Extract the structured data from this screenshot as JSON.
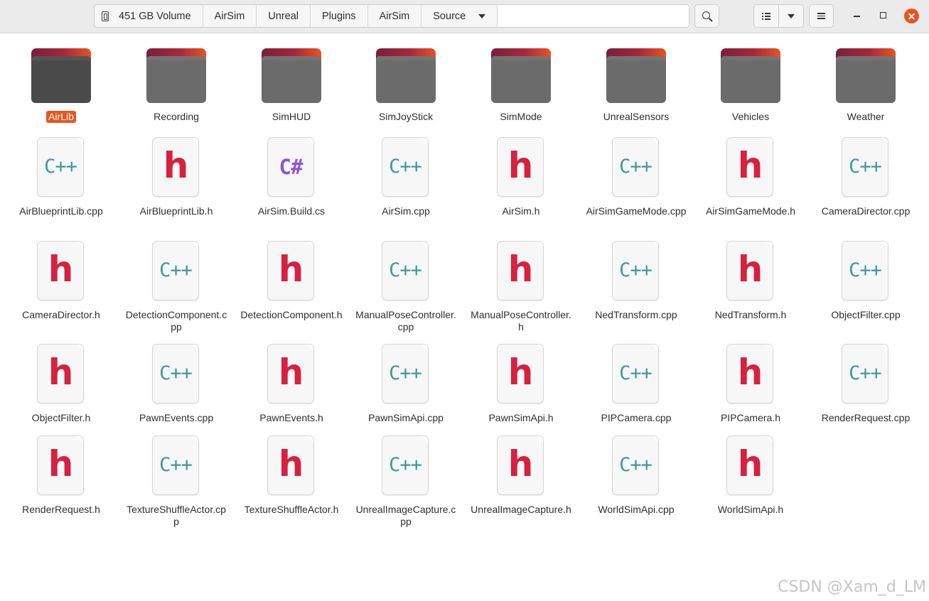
{
  "breadcrumbs": [
    {
      "label": "451 GB Volume",
      "icon": "drive-icon"
    },
    {
      "label": "AirSim"
    },
    {
      "label": "Unreal"
    },
    {
      "label": "Plugins"
    },
    {
      "label": "AirSim"
    },
    {
      "label": "Source",
      "has_dropdown": true
    }
  ],
  "colors": {
    "accent": "#e95420",
    "cpp_glyph": "#3d9a9e",
    "h_glyph": "#d6213f",
    "cs_glyph": "#8f56c9"
  },
  "files": [
    {
      "name": "AirLib",
      "type": "folder",
      "selected": true
    },
    {
      "name": "Recording",
      "type": "folder"
    },
    {
      "name": "SimHUD",
      "type": "folder"
    },
    {
      "name": "SimJoyStick",
      "type": "folder"
    },
    {
      "name": "SimMode",
      "type": "folder"
    },
    {
      "name": "UnrealSensors",
      "type": "folder"
    },
    {
      "name": "Vehicles",
      "type": "folder"
    },
    {
      "name": "Weather",
      "type": "folder"
    },
    {
      "name": "AirBlueprintLib.cpp",
      "type": "cpp",
      "glyph": "C++"
    },
    {
      "name": "AirBlueprintLib.h",
      "type": "h",
      "glyph": "h"
    },
    {
      "name": "AirSim.Build.cs",
      "type": "cs",
      "glyph": "C#"
    },
    {
      "name": "AirSim.cpp",
      "type": "cpp",
      "glyph": "C++"
    },
    {
      "name": "AirSim.h",
      "type": "h",
      "glyph": "h"
    },
    {
      "name": "AirSimGameMode.cpp",
      "type": "cpp",
      "glyph": "C++"
    },
    {
      "name": "AirSimGameMode.h",
      "type": "h",
      "glyph": "h"
    },
    {
      "name": "CameraDirector.cpp",
      "type": "cpp",
      "glyph": "C++"
    },
    {
      "name": "CameraDirector.h",
      "type": "h",
      "glyph": "h"
    },
    {
      "name": "DetectionComponent.cpp",
      "type": "cpp",
      "glyph": "C++"
    },
    {
      "name": "DetectionComponent.h",
      "type": "h",
      "glyph": "h"
    },
    {
      "name": "ManualPoseController.cpp",
      "type": "cpp",
      "glyph": "C++"
    },
    {
      "name": "ManualPoseController.h",
      "type": "h",
      "glyph": "h"
    },
    {
      "name": "NedTransform.cpp",
      "type": "cpp",
      "glyph": "C++"
    },
    {
      "name": "NedTransform.h",
      "type": "h",
      "glyph": "h"
    },
    {
      "name": "ObjectFilter.cpp",
      "type": "cpp",
      "glyph": "C++"
    },
    {
      "name": "ObjectFilter.h",
      "type": "h",
      "glyph": "h"
    },
    {
      "name": "PawnEvents.cpp",
      "type": "cpp",
      "glyph": "C++"
    },
    {
      "name": "PawnEvents.h",
      "type": "h",
      "glyph": "h"
    },
    {
      "name": "PawnSimApi.cpp",
      "type": "cpp",
      "glyph": "C++"
    },
    {
      "name": "PawnSimApi.h",
      "type": "h",
      "glyph": "h"
    },
    {
      "name": "PIPCamera.cpp",
      "type": "cpp",
      "glyph": "C++"
    },
    {
      "name": "PIPCamera.h",
      "type": "h",
      "glyph": "h"
    },
    {
      "name": "RenderRequest.cpp",
      "type": "cpp",
      "glyph": "C++"
    },
    {
      "name": "RenderRequest.h",
      "type": "h",
      "glyph": "h"
    },
    {
      "name": "TextureShuffleActor.cpp",
      "type": "cpp",
      "glyph": "C++"
    },
    {
      "name": "TextureShuffleActor.h",
      "type": "h",
      "glyph": "h"
    },
    {
      "name": "UnrealImageCapture.cpp",
      "type": "cpp",
      "glyph": "C++"
    },
    {
      "name": "UnrealImageCapture.h",
      "type": "h",
      "glyph": "h"
    },
    {
      "name": "WorldSimApi.cpp",
      "type": "cpp",
      "glyph": "C++"
    },
    {
      "name": "WorldSimApi.h",
      "type": "h",
      "glyph": "h"
    }
  ],
  "watermark": "CSDN @Xam_d_LM"
}
